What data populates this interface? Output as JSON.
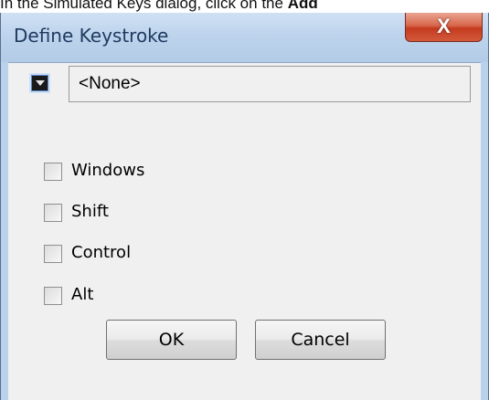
{
  "caption": {
    "prefix": "In the Simulated Keys dialog, click on the ",
    "bold": "Add"
  },
  "window": {
    "title": "Define Keystroke",
    "close_glyph": "X"
  },
  "keystroke": {
    "value": "<None>"
  },
  "modifiers": [
    {
      "label": "Windows",
      "checked": false
    },
    {
      "label": "Shift",
      "checked": false
    },
    {
      "label": "Control",
      "checked": false
    },
    {
      "label": "Alt",
      "checked": false
    }
  ],
  "buttons": {
    "ok_label": "OK",
    "cancel_label": "Cancel"
  },
  "colors": {
    "titlebar": "#bcd3ec",
    "close_button": "#c43b1f",
    "client": "#f0f0f0"
  }
}
